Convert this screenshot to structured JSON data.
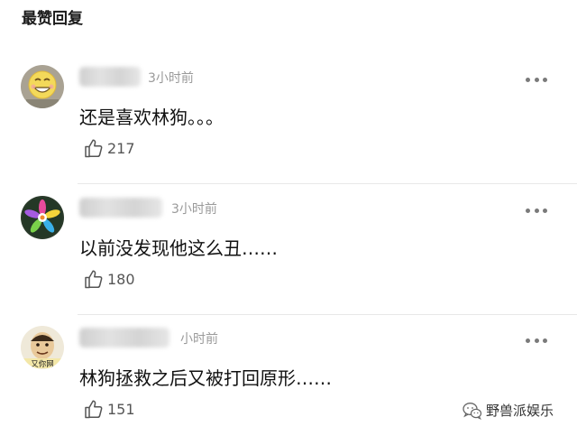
{
  "section": {
    "title": "最赞回复"
  },
  "comments": [
    {
      "time": "3小时前",
      "content": "还是喜欢林狗。。。",
      "likes": "217",
      "avatar_icon": "smiley-avatar-icon"
    },
    {
      "time": "3小时前",
      "content": "以前没发现他这么丑……",
      "likes": "180",
      "avatar_icon": "flower-avatar-icon"
    },
    {
      "time": "小时前",
      "content": "林狗拯救之后又被打回原形……",
      "likes": "151",
      "avatar_icon": "meme-avatar-icon"
    }
  ],
  "watermark": {
    "text": "野兽派娱乐",
    "icon": "wechat-icon"
  },
  "avatar_caption": "又你网"
}
